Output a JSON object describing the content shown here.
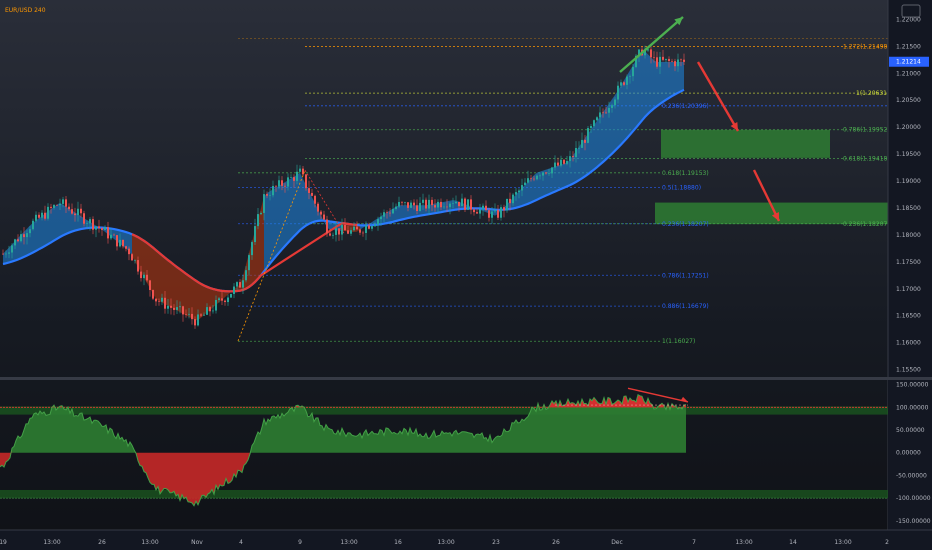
{
  "title": "EUR/USD 240",
  "price_axis": {
    "ticks": [
      "1.22000",
      "1.21500",
      "1.21000",
      "1.20500",
      "1.20000",
      "1.19500",
      "1.19000",
      "1.18500",
      "1.18000",
      "1.17500",
      "1.17000",
      "1.16500",
      "1.16000",
      "1.15500"
    ],
    "current_price": "1.21214"
  },
  "osc_axis": {
    "ticks": [
      "150.00000",
      "100.00000",
      "50.00000",
      "0.00000",
      "-50.00000",
      "-100.00000",
      "-150.00000"
    ]
  },
  "time_axis": {
    "labels": [
      "19",
      "13:00",
      "26",
      "13:00",
      "Nov",
      "4",
      "9",
      "13:00",
      "16",
      "13:00",
      "23",
      "26",
      "Dec",
      "7",
      "13:00",
      "14",
      "13:00",
      "2"
    ]
  },
  "fib_retracement": [
    {
      "label": "0.236(1.18207)",
      "color": "#2962ff"
    },
    {
      "label": "0.5(1.18880)",
      "color": "#2962ff"
    },
    {
      "label": "0.618(1.19153)",
      "color": "#4caf50"
    },
    {
      "label": "0.786(1.17251)",
      "color": "#2962ff"
    },
    {
      "label": "0.886(1.16679)",
      "color": "#2962ff"
    },
    {
      "label": "1(1.16027)",
      "color": "#4caf50"
    }
  ],
  "fib_extension": [
    {
      "label": "1.272(1.21498)",
      "color": "#ff9800"
    },
    {
      "label": "1(1.20631)",
      "color": "#cddc39"
    },
    {
      "label": "0.236(1.20396)",
      "color": "#2962ff"
    },
    {
      "label": "0.786(1.19952)",
      "color": "#4caf50"
    },
    {
      "label": "0.618(1.19418)",
      "color": "#4caf50"
    },
    {
      "label": "0.236(1.18207)",
      "color": "#4caf50"
    }
  ],
  "colors": {
    "up": "#2196f3",
    "down": "#e53935",
    "zone": "#2e7d32",
    "arrow_red": "#e53935",
    "arrow_green": "#4caf50"
  },
  "chart_data": [
    {
      "type": "candlestick",
      "symbol": "EUR/USD",
      "ylim": [
        1.155,
        1.223
      ],
      "close_approx": [
        [
          "Oct 19",
          1.1765
        ],
        [
          "Oct 21",
          1.182
        ],
        [
          "Oct 23",
          1.186
        ],
        [
          "Oct 26",
          1.181
        ],
        [
          "Oct 28",
          1.177
        ],
        [
          "Oct 30",
          1.168
        ],
        [
          "Nov 2",
          1.164
        ],
        [
          "Nov 4",
          1.171
        ],
        [
          "Nov 6",
          1.1875
        ],
        [
          "Nov 9",
          1.1915
        ],
        [
          "Nov 11",
          1.181
        ],
        [
          "Nov 13",
          1.1805
        ],
        [
          "Nov 16",
          1.1855
        ],
        [
          "Nov 18",
          1.1855
        ],
        [
          "Nov 20",
          1.1865
        ],
        [
          "Nov 23",
          1.1835
        ],
        [
          "Nov 25",
          1.1915
        ],
        [
          "Nov 27",
          1.1935
        ],
        [
          "Dec 1",
          1.2065
        ],
        [
          "Dec 3",
          1.2145
        ],
        [
          "Dec 4",
          1.2121
        ]
      ]
    },
    {
      "type": "area",
      "name": "oscillator",
      "ylim": [
        -160,
        160
      ],
      "levels": [
        100,
        -100
      ],
      "values_approx": [
        [
          "Oct 19",
          -30
        ],
        [
          "Oct 21",
          80
        ],
        [
          "Oct 23",
          100
        ],
        [
          "Oct 26",
          60
        ],
        [
          "Oct 28",
          20
        ],
        [
          "Oct 30",
          -80
        ],
        [
          "Nov 2",
          -110
        ],
        [
          "Nov 4",
          -40
        ],
        [
          "Nov 6",
          70
        ],
        [
          "Nov 9",
          100
        ],
        [
          "Nov 11",
          50
        ],
        [
          "Nov 13",
          40
        ],
        [
          "Nov 16",
          50
        ],
        [
          "Nov 18",
          40
        ],
        [
          "Nov 20",
          45
        ],
        [
          "Nov 23",
          30
        ],
        [
          "Nov 25",
          100
        ],
        [
          "Nov 27",
          110
        ],
        [
          "Dec 1",
          115
        ],
        [
          "Dec 3",
          120
        ],
        [
          "Dec 4",
          100
        ]
      ]
    }
  ]
}
